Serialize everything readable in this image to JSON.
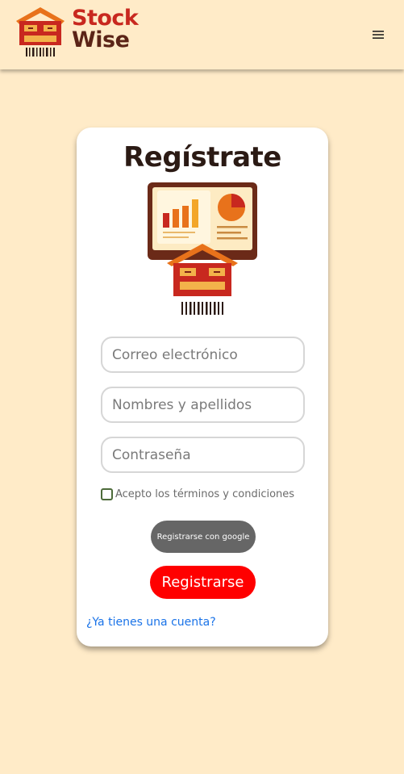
{
  "header": {
    "brand_line1": "Stock",
    "brand_line2": "Wise",
    "menu_icon": "hamburger-menu-icon"
  },
  "colors": {
    "background": "#ffebc8",
    "brand_red": "#c8281f",
    "brand_brown": "#5b2417",
    "primary_button": "#ff0000",
    "google_button": "#666666",
    "link": "#1a73e8"
  },
  "form": {
    "title": "Regístrate",
    "email_placeholder": "Correo electrónico",
    "name_placeholder": "Nombres y apellidos",
    "password_placeholder": "Contraseña",
    "terms_label": "Acepto los términos y condiciones",
    "terms_checked": false,
    "google_button_label": "Registrarse con google",
    "register_button_label": "Registrarse",
    "login_link": "¿Ya tienes una cuenta?"
  }
}
